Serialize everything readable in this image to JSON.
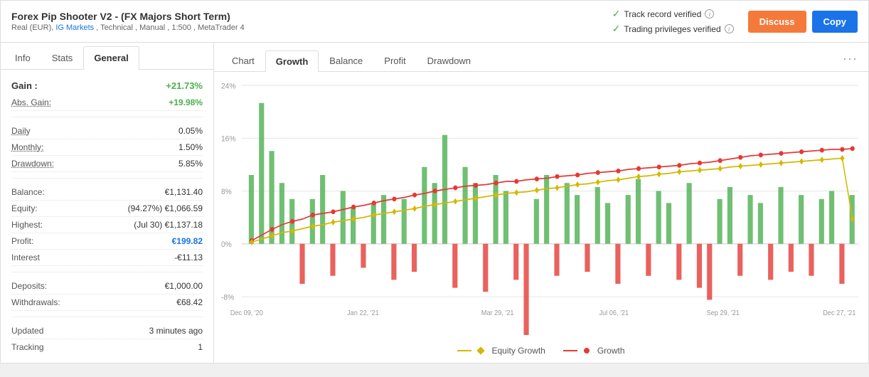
{
  "header": {
    "title": "Forex Pip Shooter V2 - (FX Majors Short Term)",
    "subtitle": "Real (EUR), IG Markets , Technical , Manual , 1:500 , MetaTrader 4",
    "verified_track": "Track record verified",
    "verified_trading": "Trading privileges verified",
    "btn_discuss": "Discuss",
    "btn_copy": "Copy"
  },
  "left_tabs": [
    {
      "label": "Info",
      "active": false
    },
    {
      "label": "Stats",
      "active": false
    },
    {
      "label": "General",
      "active": true
    }
  ],
  "stats": {
    "gain_label": "Gain :",
    "gain_value": "+21.73%",
    "abs_gain_label": "Abs. Gain:",
    "abs_gain_value": "+19.98%",
    "daily_label": "Daily",
    "daily_value": "0.05%",
    "monthly_label": "Monthly:",
    "monthly_value": "1.50%",
    "drawdown_label": "Drawdown:",
    "drawdown_value": "5.85%",
    "balance_label": "Balance:",
    "balance_value": "€1,131.40",
    "equity_label": "Equity:",
    "equity_value": "(94.27%) €1,066.59",
    "highest_label": "Highest:",
    "highest_value": "(Jul 30) €1,137.18",
    "profit_label": "Profit:",
    "profit_value": "€199.82",
    "interest_label": "Interest",
    "interest_value": "-€11.13",
    "deposits_label": "Deposits:",
    "deposits_value": "€1,000.00",
    "withdrawals_label": "Withdrawals:",
    "withdrawals_value": "€68.42",
    "updated_label": "Updated",
    "updated_value": "3 minutes ago",
    "tracking_label": "Tracking",
    "tracking_value": "1"
  },
  "chart_tabs": [
    {
      "label": "Chart",
      "active": false
    },
    {
      "label": "Growth",
      "active": true
    },
    {
      "label": "Balance",
      "active": false
    },
    {
      "label": "Profit",
      "active": false
    },
    {
      "label": "Drawdown",
      "active": false
    }
  ],
  "chart": {
    "menu_icon": "⋯",
    "y_labels": [
      "24%",
      "16%",
      "8%",
      "0%",
      "-8%"
    ],
    "x_labels": [
      "Dec 09, '20",
      "Jan 22, '21",
      "Mar 29, '21",
      "Jul 06, '21",
      "Sep 29, '21",
      "Dec 27, '21"
    ],
    "legend": [
      {
        "label": "Equity Growth",
        "color": "#d4b800"
      },
      {
        "label": "Growth",
        "color": "#e53935"
      }
    ]
  }
}
